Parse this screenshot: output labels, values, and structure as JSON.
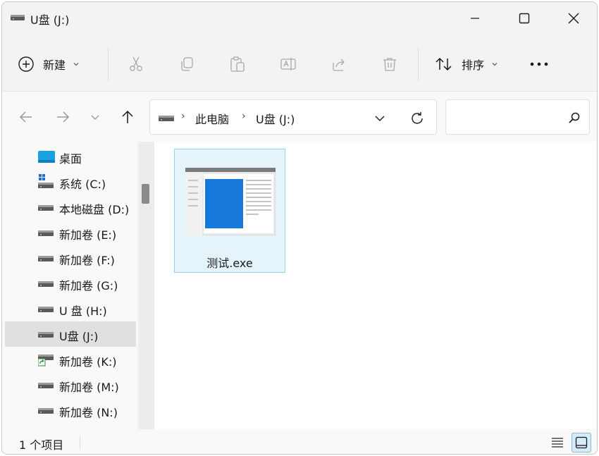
{
  "window": {
    "title": "U盘 (J:)",
    "controls": [
      "minimize",
      "maximize",
      "close"
    ]
  },
  "toolbar": {
    "new_label": "新建",
    "sort_label": "排序",
    "actions": [
      "cut-icon",
      "copy-icon",
      "paste-icon",
      "rename-icon",
      "share-icon",
      "delete-icon"
    ],
    "more_icon": "more-icon"
  },
  "address": {
    "crumbs": [
      "此电脑",
      "U盘 (J:)"
    ],
    "search_placeholder": ""
  },
  "sidebar": {
    "items": [
      {
        "label": "桌面",
        "icon": "desktop-icon"
      },
      {
        "label": "系统 (C:)",
        "icon": "windows-drive-icon"
      },
      {
        "label": "本地磁盘 (D:)",
        "icon": "drive-icon"
      },
      {
        "label": "新加卷 (E:)",
        "icon": "drive-icon"
      },
      {
        "label": "新加卷 (F:)",
        "icon": "drive-icon"
      },
      {
        "label": "新加卷 (G:)",
        "icon": "drive-icon"
      },
      {
        "label": "U 盘 (H:)",
        "icon": "drive-icon"
      },
      {
        "label": "U盘 (J:)",
        "icon": "drive-icon",
        "selected": true
      },
      {
        "label": "新加卷 (K:)",
        "icon": "shared-drive-icon"
      },
      {
        "label": "新加卷 (M:)",
        "icon": "drive-icon"
      },
      {
        "label": "新加卷 (N:)",
        "icon": "drive-icon"
      }
    ]
  },
  "files": [
    {
      "name": "测试.exe",
      "icon": "exe-file-icon",
      "selected": true
    }
  ],
  "status": {
    "count_text": "1 个项目"
  },
  "colors": {
    "accent": "#0078d4",
    "selection_bg": "#e5f3fb",
    "selection_border": "#99d1ee"
  }
}
